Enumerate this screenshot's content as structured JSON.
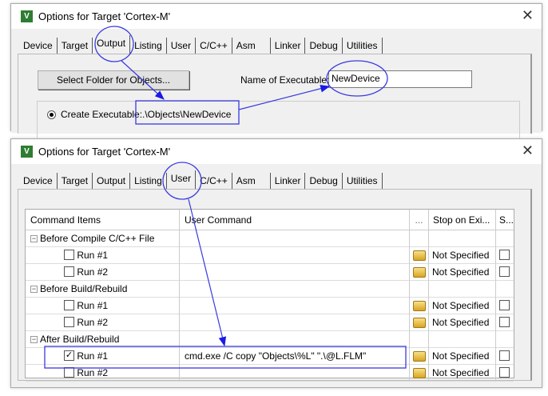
{
  "top_dialog": {
    "title": "Options for Target 'Cortex-M'",
    "tabs": [
      "Device",
      "Target",
      "Output",
      "Listing",
      "User",
      "C/C++",
      "Asm",
      "Linker",
      "Debug",
      "Utilities"
    ],
    "selected_tab": "Output",
    "select_folder_button": "Select Folder for Objects...",
    "name_of_executable_label": "Name of Executable:",
    "name_of_executable_value": "NewDevice",
    "create_executable_label": "Create Executable:",
    "create_executable_path": ".\\Objects\\NewDevice"
  },
  "bottom_dialog": {
    "title": "Options for Target 'Cortex-M'",
    "tabs": [
      "Device",
      "Target",
      "Output",
      "Listing",
      "User",
      "C/C++",
      "Asm",
      "Linker",
      "Debug",
      "Utilities"
    ],
    "selected_tab": "User",
    "columns": [
      "Command Items",
      "User Command",
      "...",
      "Stop on Exi...",
      "S..."
    ],
    "groups": [
      {
        "label": "Before Compile C/C++ File",
        "items": [
          {
            "label": "Run #1",
            "checked": false,
            "command": "",
            "stop": "Not Specified"
          },
          {
            "label": "Run #2",
            "checked": false,
            "command": "",
            "stop": "Not Specified"
          }
        ]
      },
      {
        "label": "Before Build/Rebuild",
        "items": [
          {
            "label": "Run #1",
            "checked": false,
            "command": "",
            "stop": "Not Specified"
          },
          {
            "label": "Run #2",
            "checked": false,
            "command": "",
            "stop": "Not Specified"
          }
        ]
      },
      {
        "label": "After Build/Rebuild",
        "items": [
          {
            "label": "Run #1",
            "checked": true,
            "command": "cmd.exe /C copy \"Objects\\%L\" \".\\@L.FLM\"",
            "stop": "Not Specified"
          },
          {
            "label": "Run #2",
            "checked": false,
            "command": "",
            "stop": "Not Specified"
          }
        ]
      }
    ]
  },
  "colors": {
    "annotation": "#2020e0",
    "dialog_bg": "#f0f0f0"
  }
}
